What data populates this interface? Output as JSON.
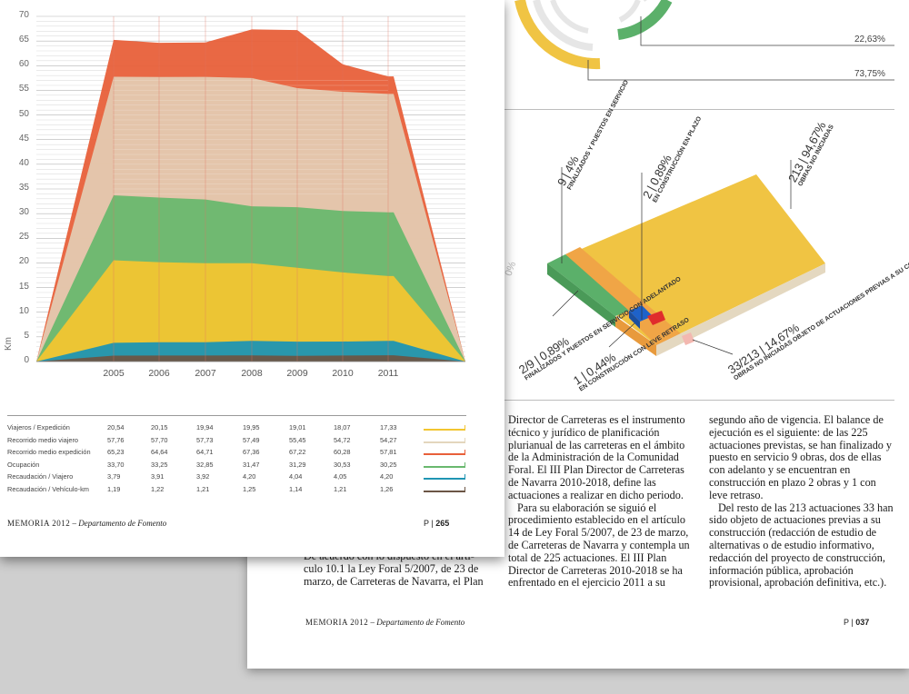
{
  "back_page": {
    "donut_labels": [
      "22,63%",
      "73,75%"
    ],
    "block_labels": {
      "finalized": {
        "value": "9 | 4%",
        "text": "FINALIZADOS Y PUESTOS EN SERVICIO"
      },
      "in_plazo": {
        "value": "2 | 0,89%",
        "text": "EN CONSTRUCCIÓN EN PLAZO"
      },
      "not_started": {
        "value": "213 | 94,67%",
        "text": "OBRAS NO INICIADAS"
      },
      "advance": {
        "value": "2/9 | 0,89%",
        "text": "FINALIZADOS Y PUESTOS EN SERVICIO CON ADELANTADO"
      },
      "delay": {
        "value": "1 | 0,44%",
        "text": "EN CONSTRUCCIÓN CON LEVE RETRASO"
      },
      "previous": {
        "value": "33/213 | 14,67%",
        "text": "OBRAS NO INICIADAS OBJETO DE ACTUACIONES PREVIAS A SU CONSTRUCCIÓN"
      },
      "partial_left": "0%"
    },
    "col_left_hidden_top": "De acuerdo con lo dispuesto en el artí-",
    "col_left": "culo 10.1 la Ley Foral 5/2007, de 23 de marzo, de Carreteras de Navarra, el Plan",
    "col_mid": [
      "Director de Carreteras es el instrumento técnico y jurídico de planificación plurianual de las carreteras en el ámbito de la Administración de la Comunidad Foral. El III Plan Director de Carreteras de Navarra 2010-2018, define las actuaciones a realizar en dicho periodo.",
      "Para su elaboración se siguió el procedimiento establecido en el artículo 14 de Ley Foral 5/2007, de 23 de marzo, de Carreteras de Navarra y contempla un total de 225 actuaciones. El III Plan Director de Carreteras 2010-2018 se ha enfrentado en el ejercicio 2011 a su"
    ],
    "col_right": [
      "segundo año de vigencia. El balance de ejecución es el siguiente: de las 225 actuaciones previstas, se han finalizado y puesto en servicio 9 obras, dos de ellas con adelanto y se encuentran en construcción en plazo 2 obras y 1 con leve retraso.",
      "Del resto de las 213 actuaciones 33 han sido objeto de actuaciones previas a su construcción (redacción de estudio de alternativas o de estudio informativo, redacción del proyecto de construcción, información pública, aprobación provisional, aprobación definitiva, etc.)."
    ],
    "footer_title": "MEMORIA 2012",
    "footer_sep": " – ",
    "footer_dept": "Departamento de Fomento",
    "page_letter": "P",
    "page_number": "037"
  },
  "front_page": {
    "footer_title": "MEMORIA 2012",
    "footer_sep": " – ",
    "footer_dept": "Departamento de Fomento",
    "page_letter": "P",
    "page_number": "265",
    "table": {
      "rows": [
        {
          "label": "Viajeros / Expedición",
          "values": [
            "20,54",
            "20,15",
            "19,94",
            "19,95",
            "19,01",
            "18,07",
            "17,33"
          ],
          "color": "#f2c530"
        },
        {
          "label": "Recorrido medio viajero",
          "values": [
            "57,76",
            "57,70",
            "57,73",
            "57,49",
            "55,45",
            "54,72",
            "54,27"
          ],
          "color": "#e3d6bd"
        },
        {
          "label": "Recorrido medio expedición",
          "values": [
            "65,23",
            "64,64",
            "64,71",
            "67,36",
            "67,22",
            "60,28",
            "57,81"
          ],
          "color": "#e8603a"
        },
        {
          "label": "Ocupación",
          "values": [
            "33,70",
            "33,25",
            "32,85",
            "31,47",
            "31,29",
            "30,53",
            "30,25"
          ],
          "color": "#69b86e"
        },
        {
          "label": "Recaudación / Viajero",
          "values": [
            "3,79",
            "3,91",
            "3,92",
            "4,20",
            "4,04",
            "4,05",
            "4,20"
          ],
          "color": "#1f95b3"
        },
        {
          "label": "Recaudación / Vehículo-km",
          "values": [
            "1,19",
            "1,22",
            "1,21",
            "1,25",
            "1,14",
            "1,21",
            "1,26"
          ],
          "color": "#6b5545"
        }
      ]
    }
  },
  "chart_data": {
    "type": "area",
    "ylabel": "Km",
    "ylim": [
      0,
      70
    ],
    "yticks": [
      0,
      5,
      10,
      15,
      20,
      25,
      30,
      35,
      40,
      45,
      50,
      55,
      60,
      65,
      70
    ],
    "x": [
      "2005",
      "2006",
      "2007",
      "2008",
      "2009",
      "2010",
      "2011"
    ],
    "series": [
      {
        "name": "Recorrido medio expedición",
        "color": "#e8603a",
        "values": [
          65.23,
          64.64,
          64.71,
          67.36,
          67.22,
          60.28,
          57.81
        ]
      },
      {
        "name": "Recorrido medio viajero",
        "color": "#e3d6bd",
        "values": [
          57.76,
          57.7,
          57.73,
          57.49,
          55.45,
          54.72,
          54.27
        ]
      },
      {
        "name": "Ocupación",
        "color": "#69b86e",
        "values": [
          33.7,
          33.25,
          32.85,
          31.47,
          31.29,
          30.53,
          30.25
        ]
      },
      {
        "name": "Viajeros / Expedición",
        "color": "#f2c530",
        "values": [
          20.54,
          20.15,
          19.94,
          19.95,
          19.01,
          18.07,
          17.33
        ]
      },
      {
        "name": "Recaudación / Viajero",
        "color": "#1f95b3",
        "values": [
          3.79,
          3.91,
          3.92,
          4.2,
          4.04,
          4.05,
          4.2
        ]
      },
      {
        "name": "Recaudación / Vehículo-km",
        "color": "#6b5545",
        "values": [
          1.19,
          1.22,
          1.21,
          1.25,
          1.14,
          1.21,
          1.26
        ]
      }
    ],
    "grid": true
  },
  "iso_colors": {
    "yellow": "#f0c443",
    "orange": "#f0a546",
    "green": "#5bb06a",
    "beige": "#e4d8c0",
    "blue": "#1e62c9",
    "red": "#e02c2c",
    "pink": "#f3b8b0"
  }
}
